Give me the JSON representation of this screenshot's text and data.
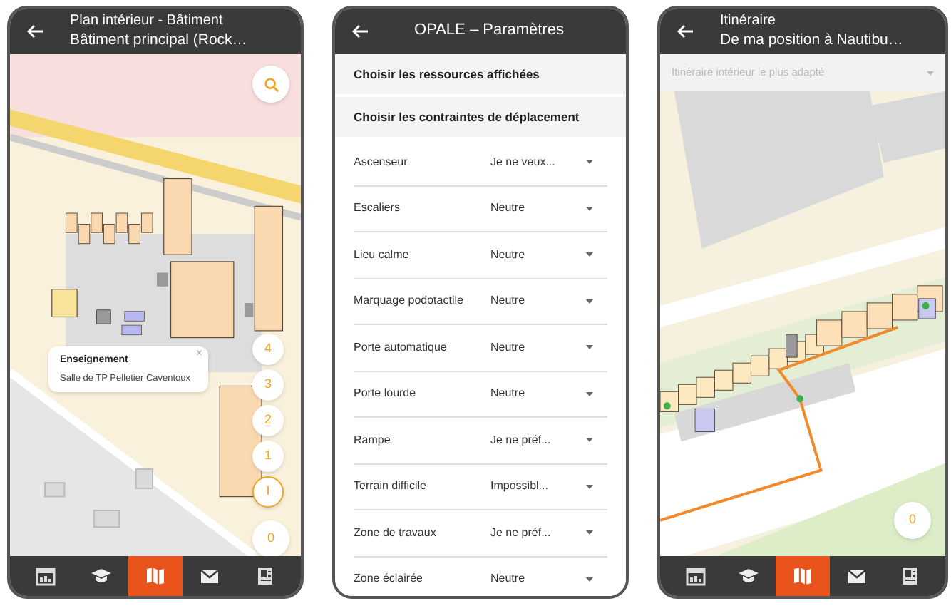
{
  "screens": [
    {
      "kind": "map",
      "header": {
        "title": "Plan intérieur - Bâtiment",
        "subtitle": "Bâtiment principal (Rock…"
      },
      "popup": {
        "category": "Enseignement",
        "room": "Salle de TP Pelletier Caventoux",
        "close": "×"
      },
      "floors": [
        {
          "label": "4",
          "selected": false
        },
        {
          "label": "3",
          "selected": false
        },
        {
          "label": "2",
          "selected": false
        },
        {
          "label": "1",
          "selected": false
        },
        {
          "label": "I",
          "selected": true
        },
        {
          "label": "0",
          "selected": false
        }
      ],
      "nav": [
        {
          "kind": "calendar",
          "selected": false
        },
        {
          "kind": "school",
          "selected": false
        },
        {
          "kind": "map",
          "selected": true
        },
        {
          "kind": "mail",
          "selected": false
        },
        {
          "kind": "document",
          "selected": false
        }
      ]
    },
    {
      "kind": "settings",
      "header": {
        "title": "OPALE – Paramètres"
      },
      "sections": [
        "Choisir les ressources affichées",
        "Choisir les contraintes de déplacement"
      ],
      "rows": [
        {
          "label": "Ascenseur",
          "value": "Je ne veux..."
        },
        {
          "label": "Escaliers",
          "value": "Neutre"
        },
        {
          "label": "Lieu calme",
          "value": "Neutre"
        },
        {
          "label": "Marquage podotactile",
          "value": "Neutre"
        },
        {
          "label": "Porte automatique",
          "value": "Neutre"
        },
        {
          "label": "Porte lourde",
          "value": "Neutre"
        },
        {
          "label": "Rampe",
          "value": "Je ne préf..."
        },
        {
          "label": "Terrain difficile",
          "value": "Impossibl..."
        },
        {
          "label": "Zone de travaux",
          "value": "Je ne préf..."
        },
        {
          "label": "Zone éclairée",
          "value": "Neutre"
        }
      ]
    },
    {
      "kind": "route",
      "header": {
        "title": "Itinéraire",
        "subtitle": "De ma position à Nautibu…"
      },
      "route_select": {
        "placeholder": "Itinéraire intérieur le plus adapté"
      },
      "floors": [
        {
          "label": "0",
          "selected": false
        }
      ],
      "nav": [
        {
          "kind": "calendar",
          "selected": false
        },
        {
          "kind": "school",
          "selected": false
        },
        {
          "kind": "map",
          "selected": true
        },
        {
          "kind": "mail",
          "selected": false
        },
        {
          "kind": "document",
          "selected": false
        }
      ]
    }
  ]
}
